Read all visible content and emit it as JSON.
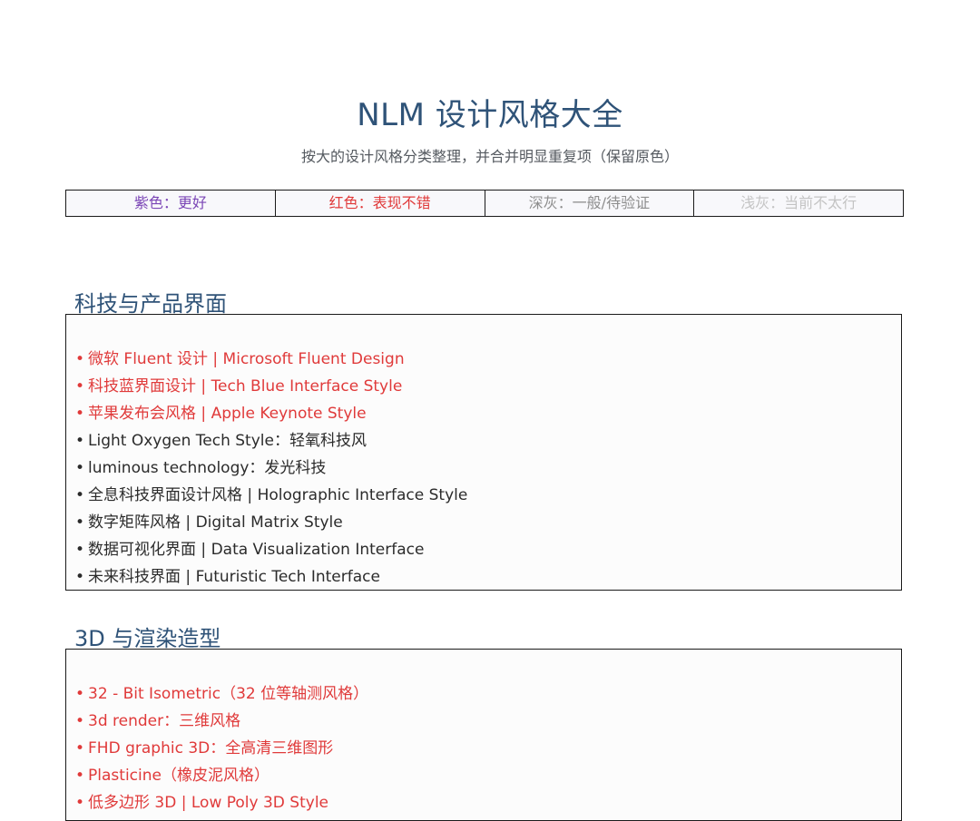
{
  "header": {
    "title": "NLM 设计风格大全",
    "subtitle": "按大的设计风格分类整理，并合并明显重复项（保留原色）"
  },
  "legend": [
    {
      "label": "紫色：更好",
      "color": "#7b46b6"
    },
    {
      "label": "红色：表现不错",
      "color": "#e03a3a"
    },
    {
      "label": "深灰：一般/待验证",
      "color": "#8e8e8e"
    },
    {
      "label": "浅灰：当前不太行",
      "color": "#c4c4c4"
    }
  ],
  "colors": {
    "title": "#2f5378",
    "red": "#e03a3a",
    "dark": "#2b2b2b"
  },
  "sections": [
    {
      "title": "科技与产品界面",
      "items": [
        {
          "bullet": "•",
          "text": "微软 Fluent 设计 | Microsoft Fluent Design",
          "tone": "red"
        },
        {
          "bullet": "•",
          "text": "科技蓝界面设计 | Tech Blue Interface Style",
          "tone": "red"
        },
        {
          "bullet": "•",
          "text": "苹果发布会风格 | Apple Keynote Style",
          "tone": "red"
        },
        {
          "bullet": "•",
          "text": "Light Oxygen Tech Style：轻氧科技风",
          "tone": "dark"
        },
        {
          "bullet": "•",
          "text": "luminous technology：发光科技",
          "tone": "dark"
        },
        {
          "bullet": "•",
          "text": "全息科技界面设计风格 | Holographic Interface Style",
          "tone": "dark"
        },
        {
          "bullet": "•",
          "text": "数字矩阵风格 | Digital Matrix Style",
          "tone": "dark"
        },
        {
          "bullet": "•",
          "text": "数据可视化界面 | Data Visualization Interface",
          "tone": "dark"
        },
        {
          "bullet": "•",
          "text": "未来科技界面 | Futuristic Tech Interface",
          "tone": "dark"
        }
      ]
    },
    {
      "title": "3D 与渲染造型",
      "items": [
        {
          "bullet": "•",
          "text": "32 - Bit Isometric（32 位等轴测风格）",
          "tone": "red"
        },
        {
          "bullet": "•",
          "text": "3d render：三维风格",
          "tone": "red"
        },
        {
          "bullet": "•",
          "text": "FHD graphic 3D：全高清三维图形",
          "tone": "red"
        },
        {
          "bullet": "•",
          "text": "Plasticine（橡皮泥风格）",
          "tone": "red"
        },
        {
          "bullet": "•",
          "text": "低多边形 3D | Low Poly 3D Style",
          "tone": "red"
        }
      ]
    }
  ]
}
